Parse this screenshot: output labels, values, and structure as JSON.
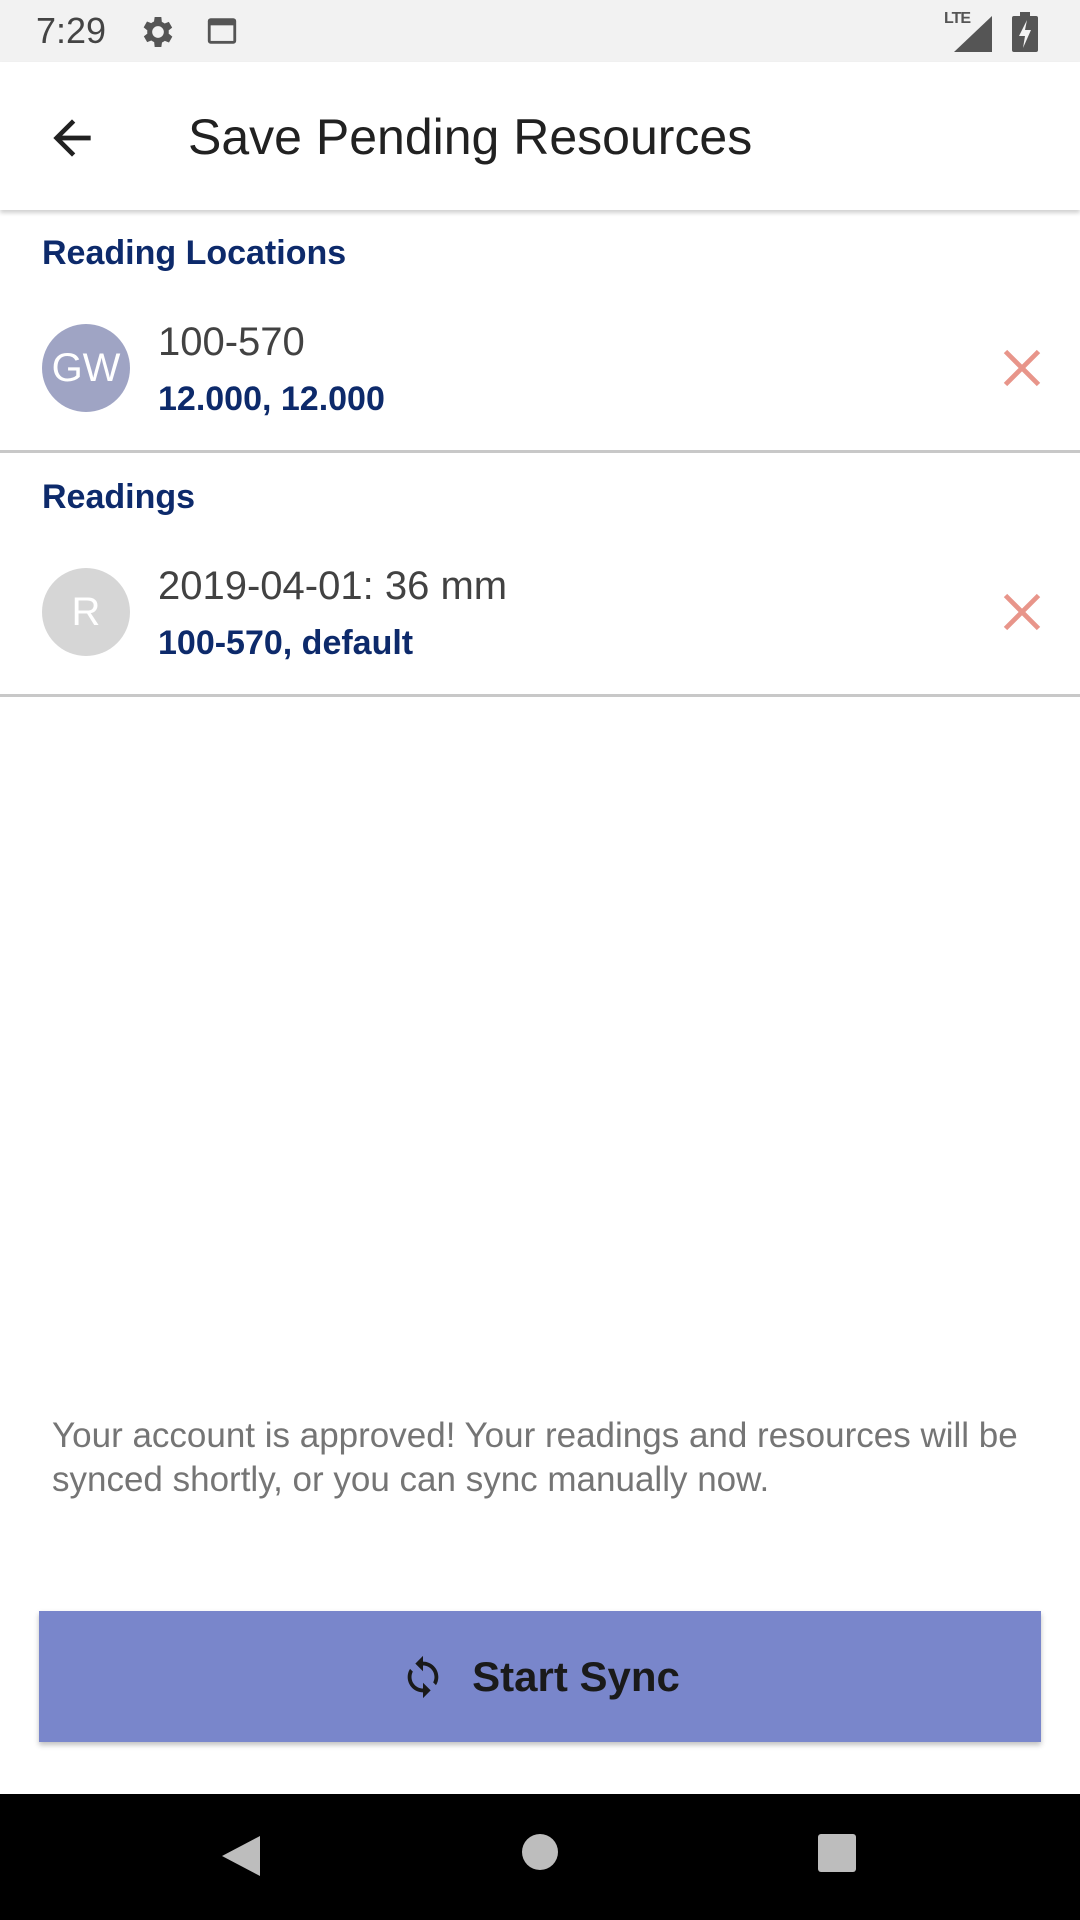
{
  "status_bar": {
    "time": "7:29",
    "network": "LTE"
  },
  "app_bar": {
    "title": "Save Pending Resources"
  },
  "sections": [
    {
      "header": "Reading Locations",
      "items": [
        {
          "avatar_text": "GW",
          "avatar_color": "#9fa4c4",
          "title": "100-570",
          "subtitle": "12.000, 12.000"
        }
      ]
    },
    {
      "header": "Readings",
      "items": [
        {
          "avatar_text": "R",
          "avatar_color": "#d6d6d6",
          "title": "2019-04-01: 36 mm",
          "subtitle": "100-570, default"
        }
      ]
    }
  ],
  "info_text": "Your account is approved! Your readings and resources will be synced shortly, or you can sync manually now.",
  "sync_button": {
    "label": "Start Sync",
    "color": "#7986cb"
  },
  "colors": {
    "accent_text": "#0d2a6b",
    "remove_icon": "#e8958a"
  }
}
